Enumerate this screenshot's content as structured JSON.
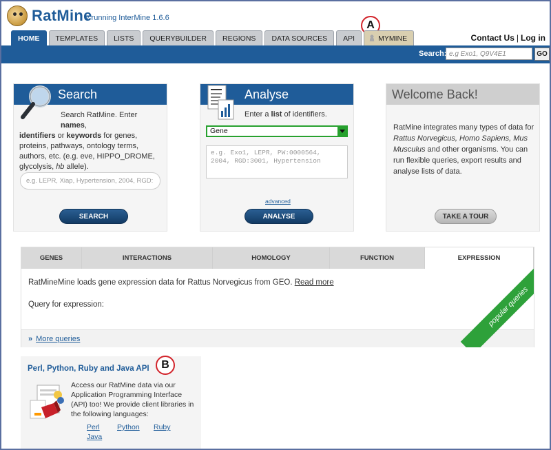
{
  "app": {
    "name": "RatMine",
    "subtitle": "v running InterMine 1.6.6"
  },
  "annotations": {
    "a": "A",
    "b": "B"
  },
  "tabs": [
    {
      "label": "HOME",
      "active": true
    },
    {
      "label": "TEMPLATES"
    },
    {
      "label": "LISTS"
    },
    {
      "label": "QUERYBUILDER"
    },
    {
      "label": "REGIONS"
    },
    {
      "label": "DATA SOURCES"
    },
    {
      "label": "API"
    },
    {
      "label": "MYMINE",
      "icon": "user-icon"
    }
  ],
  "toplinks": {
    "contact": "Contact Us",
    "separator": "|",
    "login": "Log in"
  },
  "searchbar": {
    "label": "Search:",
    "placeholder": "e.g Exo1, Q9V4E1",
    "button": "GO"
  },
  "search_box": {
    "title": "Search",
    "text_line1": "Search RatMine. Enter ",
    "names": "names",
    "comma": ",",
    "identifiers": "identifiers",
    "or": " or ",
    "keywords": "keywords",
    "text_rest": " for genes, proteins, pathways, ontology terms, authors, etc. (e.g. eve, HIPPO_DROME, glycolysis, ",
    "hb": "hb",
    "allele": " allele).",
    "placeholder": "e.g. LEPR, Xiap, Hypertension, 2004, RGD:",
    "button": "SEARCH"
  },
  "analyse_box": {
    "title": "Analyse",
    "prompt_pre": "Enter a ",
    "prompt_bold": "list",
    "prompt_post": " of identifiers.",
    "select_value": "Gene",
    "placeholder": "e.g. Exo1, LEPR, PW:0000564, 2004, RGD:3001, Hypertension",
    "advanced": "advanced",
    "button": "ANALYSE"
  },
  "welcome_box": {
    "title": "Welcome Back!",
    "text_pre": "RatMine integrates many types of data for ",
    "species": "Rattus Norvegicus, Homo Sapiens, Mus Musculus",
    "text_post": " and other organisms. You can run flexible queries, export results and analyse lists of data.",
    "button": "TAKE A TOUR"
  },
  "queries": {
    "tabs": [
      {
        "label": "GENES"
      },
      {
        "label": "INTERACTIONS"
      },
      {
        "label": "HOMOLOGY"
      },
      {
        "label": "FUNCTION"
      },
      {
        "label": "EXPRESSION",
        "active": true
      }
    ],
    "description": "RatMineMine loads gene expression data for Rattus Norvegicus from GEO.",
    "read_more": "Read more",
    "query_for": "Query for expression:",
    "more_chevron": "»",
    "more": "More queries",
    "ribbon": "popular queries"
  },
  "api": {
    "title": "Perl, Python, Ruby and Java API",
    "text": "Access our RatMine data via our Application Programming Interface (API) too! We provide client libraries in the following languages:",
    "languages": [
      "Perl",
      "Python",
      "Ruby",
      "Java"
    ]
  },
  "colors": {
    "brand": "#1f5c99",
    "accent_green": "#2ea13a",
    "annotation": "#d2232a"
  }
}
